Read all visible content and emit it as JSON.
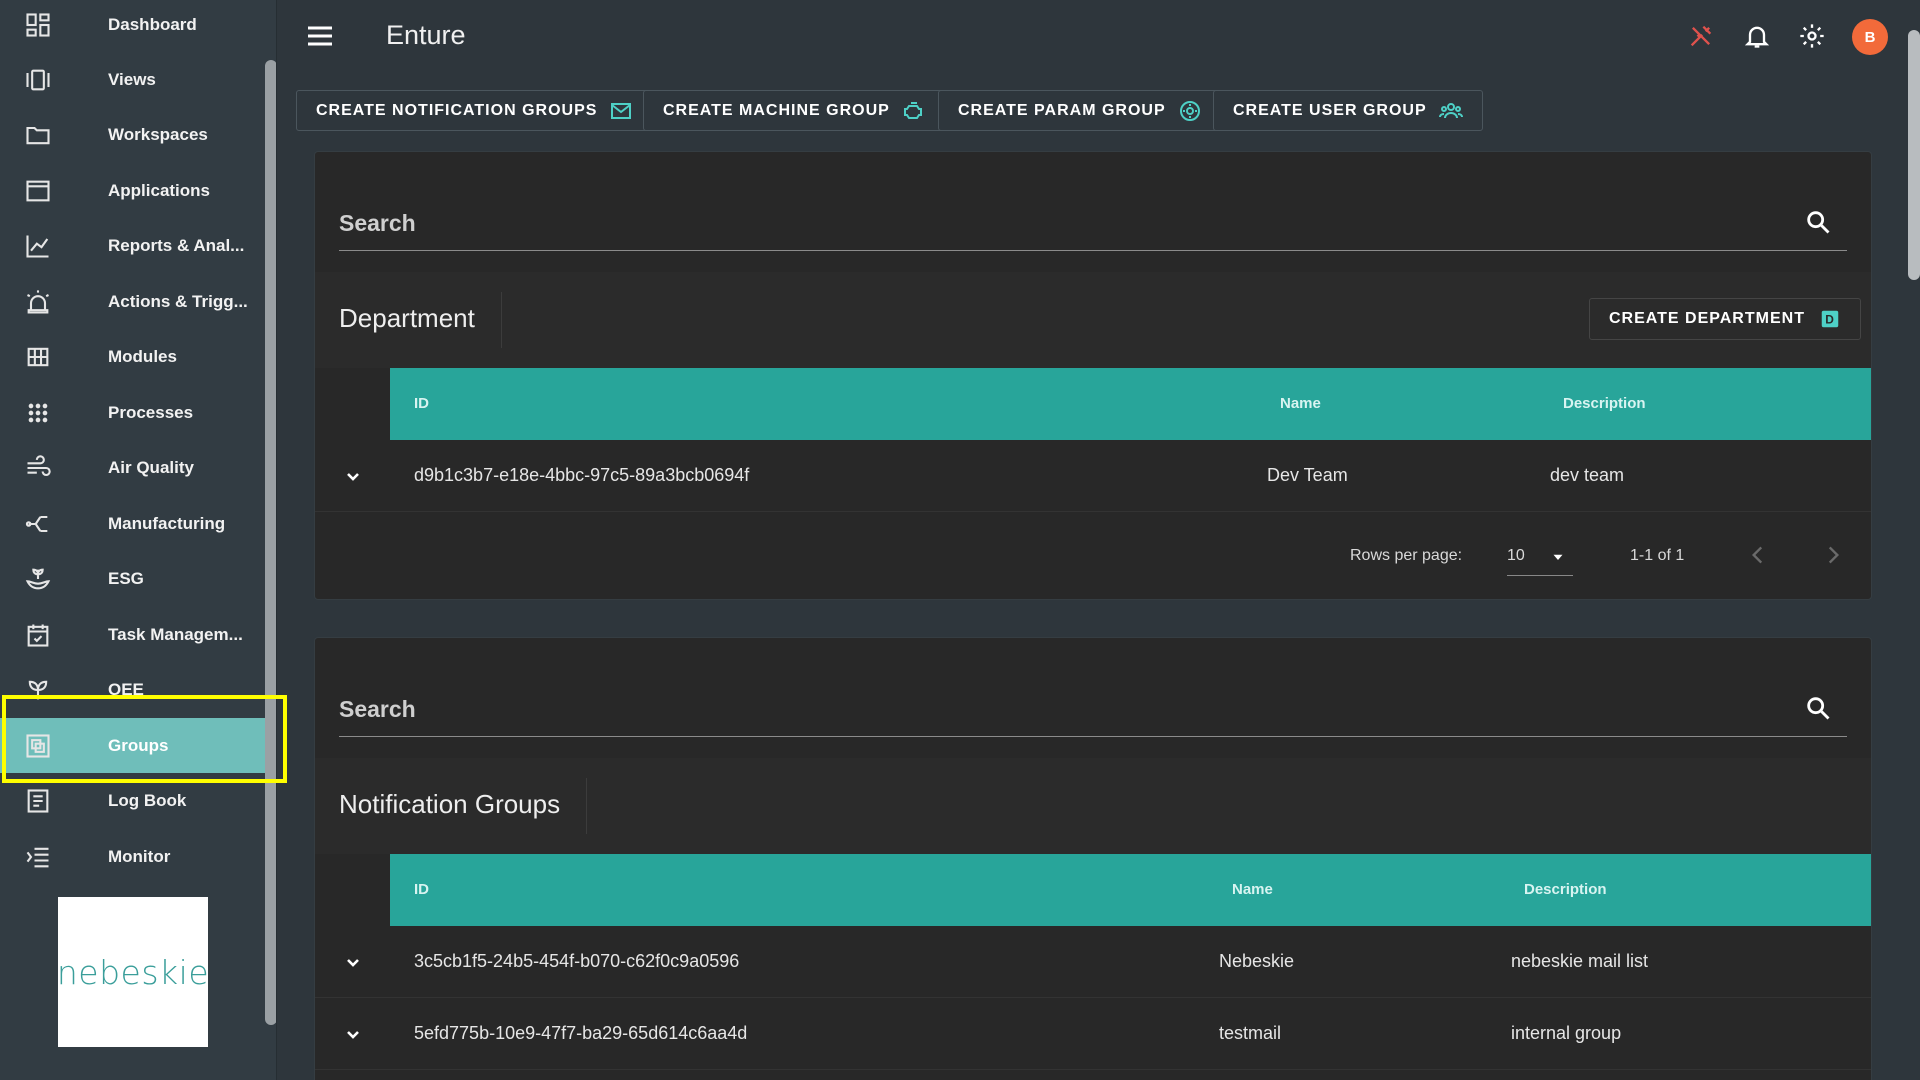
{
  "app": {
    "title": "Enture",
    "avatar_initial": "B"
  },
  "sidebar": {
    "items": [
      {
        "label": "Dashboard",
        "icon": "dashboard-icon"
      },
      {
        "label": "Views",
        "icon": "views-icon"
      },
      {
        "label": "Workspaces",
        "icon": "folder-icon"
      },
      {
        "label": "Applications",
        "icon": "window-icon"
      },
      {
        "label": "Reports & Anal...",
        "icon": "chart-line-icon"
      },
      {
        "label": "Actions & Trigg...",
        "icon": "alarm-light-icon"
      },
      {
        "label": "Modules",
        "icon": "grid-icon"
      },
      {
        "label": "Processes",
        "icon": "dots-grid-icon"
      },
      {
        "label": "Air Quality",
        "icon": "wind-icon"
      },
      {
        "label": "Manufacturing",
        "icon": "flow-icon"
      },
      {
        "label": "ESG",
        "icon": "plant-hand-icon"
      },
      {
        "label": "Task Managem...",
        "icon": "calendar-check-icon"
      },
      {
        "label": "OEE",
        "icon": "sprout-icon"
      },
      {
        "label": "Groups",
        "icon": "group-icon",
        "active": true
      },
      {
        "label": "Log Book",
        "icon": "book-icon"
      },
      {
        "label": "Monitor",
        "icon": "monitor-list-icon"
      }
    ],
    "logo_text": "nebeskie"
  },
  "actions": {
    "create_notification_groups": "CREATE NOTIFICATION GROUPS",
    "create_machine_group": "CREATE MACHINE GROUP",
    "create_param_group": "CREATE PARAM GROUP",
    "create_user_group": "CREATE USER GROUP"
  },
  "department": {
    "search_placeholder": "Search",
    "title": "Department",
    "create_label": "CREATE DEPARTMENT",
    "columns": {
      "id": "ID",
      "name": "Name",
      "description": "Description"
    },
    "rows": [
      {
        "id": "d9b1c3b7-e18e-4bbc-97c5-89a3bcb0694f",
        "name": "Dev Team",
        "description": "dev team"
      }
    ],
    "pagination": {
      "rows_per_page_label": "Rows per page:",
      "rows_per_page": "10",
      "range": "1-1 of 1"
    }
  },
  "notification_groups": {
    "search_placeholder": "Search",
    "title": "Notification Groups",
    "columns": {
      "id": "ID",
      "name": "Name",
      "description": "Description"
    },
    "rows": [
      {
        "id": "3c5cb1f5-24b5-454f-b070-c62f0c9a0596",
        "name": "Nebeskie",
        "description": "nebeskie mail list"
      },
      {
        "id": "5efd775b-10e9-47f7-ba29-65d614c6aa4d",
        "name": "testmail",
        "description": "internal group"
      }
    ]
  },
  "colors": {
    "accent_teal": "#28a59a",
    "active_nav": "#6fbeba",
    "highlight": "#ffff00",
    "avatar": "#f26a3a"
  }
}
